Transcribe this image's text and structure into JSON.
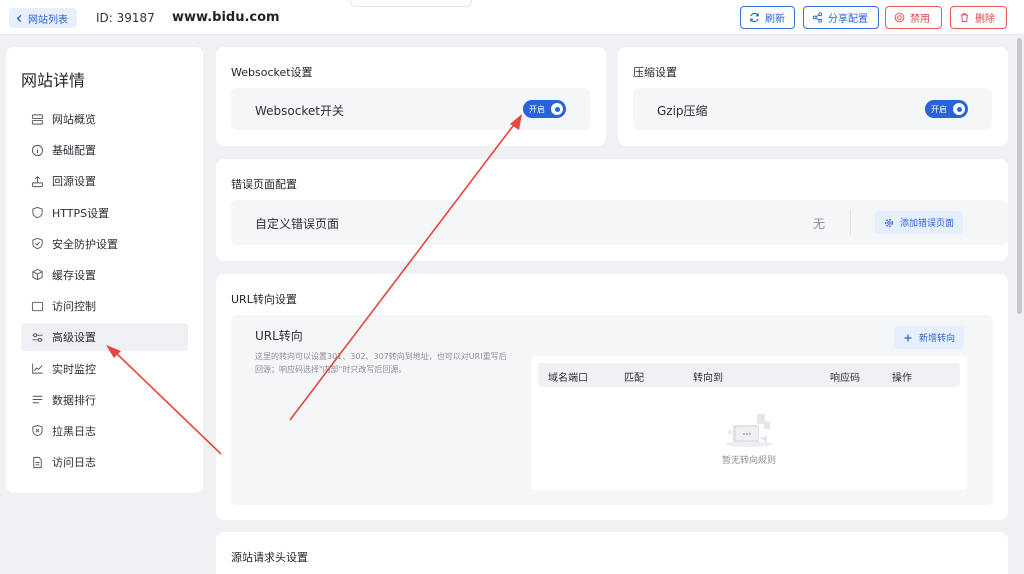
{
  "header": {
    "back_label": "网站列表",
    "site_id": "ID: 39187",
    "domain": "www.bidu.com",
    "actions": {
      "refresh": "刷新",
      "share": "分享配置",
      "disable": "禁用",
      "delete": "删除"
    }
  },
  "sidebar": {
    "title": "网站详情",
    "items": [
      {
        "label": "网站概览",
        "icon": "server-icon"
      },
      {
        "label": "基础配置",
        "icon": "info-icon"
      },
      {
        "label": "回源设置",
        "icon": "upload-icon"
      },
      {
        "label": "HTTPS设置",
        "icon": "shield-icon"
      },
      {
        "label": "安全防护设置",
        "icon": "shield-check-icon"
      },
      {
        "label": "缓存设置",
        "icon": "cube-icon"
      },
      {
        "label": "访问控制",
        "icon": "window-icon"
      },
      {
        "label": "高级设置",
        "icon": "sliders-icon",
        "active": true
      },
      {
        "label": "实时监控",
        "icon": "chart-line-icon"
      },
      {
        "label": "数据排行",
        "icon": "list-icon"
      },
      {
        "label": "拉黑日志",
        "icon": "shield-x-icon"
      },
      {
        "label": "访问日志",
        "icon": "document-icon"
      }
    ]
  },
  "websocket": {
    "title": "Websocket设置",
    "row_label": "Websocket开关",
    "toggle_label": "开启"
  },
  "compress": {
    "title": "压缩设置",
    "row_label": "Gzip压缩",
    "toggle_label": "开启"
  },
  "error_page": {
    "title": "错误页面配置",
    "row_label": "自定义错误页面",
    "value": "无",
    "add_button": "添加错误页面"
  },
  "url_redirect": {
    "title": "URL转向设置",
    "row_label": "URL转向",
    "description": "这里的转向可以设置301、302、307转向到地址，也可以对URI重写后回源；响应码选择\"内部\"时只改写后回源。",
    "add_button": "新增转向",
    "table": {
      "columns": [
        "域名端口",
        "匹配",
        "转向到",
        "响应码",
        "操作"
      ],
      "empty_text": "暂无转向规则"
    }
  },
  "origin_header": {
    "title": "源站请求头设置"
  },
  "colors": {
    "accent": "#2a62d8",
    "danger": "#e04646",
    "annotation": "#e8453c"
  }
}
